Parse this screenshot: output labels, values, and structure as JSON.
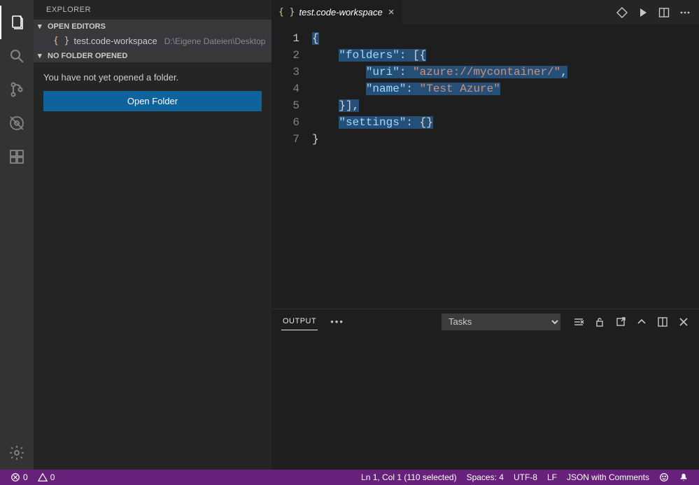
{
  "sidebar": {
    "title": "EXPLORER",
    "sections": {
      "openEditors": {
        "label": "OPEN EDITORS"
      },
      "noFolder": {
        "label": "NO FOLDER OPENED"
      }
    },
    "openEditorItem": {
      "icon": "{ }",
      "name": "test.code-workspace",
      "path": "D:\\Eigene Dateien\\Desktop\\test"
    },
    "noFolderMessage": "You have not yet opened a folder.",
    "openFolderButton": "Open Folder"
  },
  "tab": {
    "icon": "{ }",
    "title": "test.code-workspace"
  },
  "editor": {
    "lineCount": 7,
    "lines": [
      {
        "n": 1,
        "indent": 0,
        "segments": [
          {
            "cls": "tok-brace",
            "t": "{"
          }
        ],
        "selected": true
      },
      {
        "n": 2,
        "indent": 1,
        "segments": [
          {
            "cls": "tok-key",
            "t": "\"folders\""
          },
          {
            "cls": "tok-punct",
            "t": ": "
          },
          {
            "cls": "tok-punct",
            "t": "[{"
          }
        ],
        "selected": true
      },
      {
        "n": 3,
        "indent": 2,
        "segments": [
          {
            "cls": "tok-key",
            "t": "\"uri\""
          },
          {
            "cls": "tok-punct",
            "t": ": "
          },
          {
            "cls": "tok-string",
            "t": "\"azure://mycontainer/\""
          },
          {
            "cls": "tok-punct",
            "t": ","
          }
        ],
        "selected": true
      },
      {
        "n": 4,
        "indent": 2,
        "segments": [
          {
            "cls": "tok-key",
            "t": "\"name\""
          },
          {
            "cls": "tok-punct",
            "t": ": "
          },
          {
            "cls": "tok-string",
            "t": "\"Test Azure\""
          }
        ],
        "selected": true
      },
      {
        "n": 5,
        "indent": 1,
        "segments": [
          {
            "cls": "tok-punct",
            "t": "}],"
          }
        ],
        "selected": true
      },
      {
        "n": 6,
        "indent": 1,
        "segments": [
          {
            "cls": "tok-key",
            "t": "\"settings\""
          },
          {
            "cls": "tok-punct",
            "t": ": "
          },
          {
            "cls": "tok-punct",
            "t": "{}"
          }
        ],
        "selected": true
      },
      {
        "n": 7,
        "indent": 0,
        "segments": [
          {
            "cls": "tok-brace",
            "t": "}"
          }
        ],
        "selected": false
      }
    ]
  },
  "panel": {
    "tab": "OUTPUT",
    "select": {
      "value": "Tasks",
      "options": [
        "Tasks"
      ]
    }
  },
  "status": {
    "errors": "0",
    "warnings": "0",
    "lnCol": "Ln 1, Col 1 (110 selected)",
    "spaces": "Spaces: 4",
    "encoding": "UTF-8",
    "eol": "LF",
    "language": "JSON with Comments"
  }
}
